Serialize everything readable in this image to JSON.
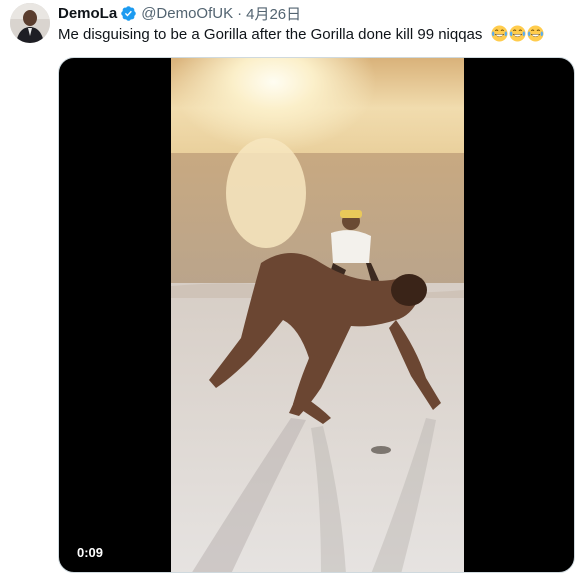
{
  "post": {
    "display_name": "DemoLa",
    "verified": true,
    "handle": "@DemoOfUK",
    "separator": "·",
    "date": "4月26日",
    "text": "Me disguising to be a Gorilla after the Gorilla done kill 99 niqqas",
    "emojis": [
      "face-with-tears-of-joy",
      "face-with-tears-of-joy",
      "face-with-tears-of-joy"
    ]
  },
  "media": {
    "type": "video",
    "duration": "0:09"
  },
  "colors": {
    "verified_badge": "#1d9bf0",
    "secondary_text": "#536471",
    "primary_text": "#0f1419"
  }
}
